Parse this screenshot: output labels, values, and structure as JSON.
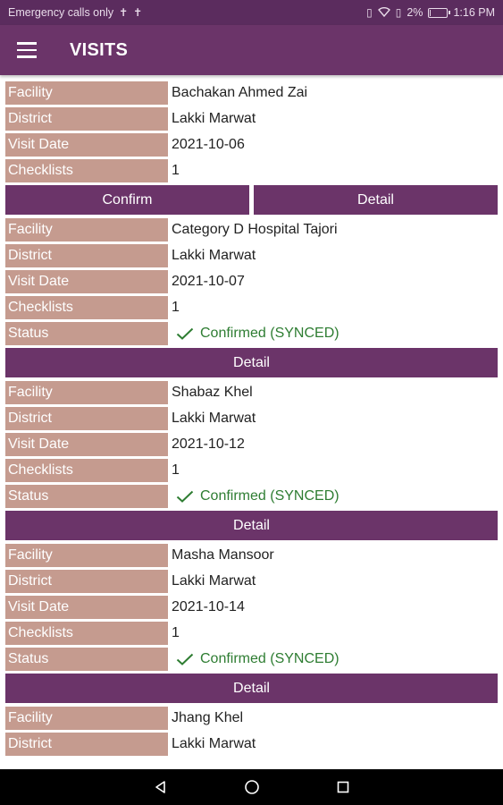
{
  "status_bar": {
    "left_text": "Emergency calls only",
    "battery": "2%",
    "time": "1:16 PM",
    "battery_level": 0.02
  },
  "app_bar": {
    "title": "VISITS"
  },
  "visits": [
    {
      "facility": {
        "label": "Facility",
        "value": "Bachakan Ahmed Zai"
      },
      "district": {
        "label": "District",
        "value": "Lakki Marwat"
      },
      "visit_date": {
        "label": "Visit Date",
        "value": "2021-10-06"
      },
      "checklists": {
        "label": "Checklists",
        "value": "1"
      },
      "confirm_label": "Confirm",
      "detail_label": "Detail"
    },
    {
      "facility": {
        "label": "Facility",
        "value": "Category D Hospital Tajori"
      },
      "district": {
        "label": "District",
        "value": "Lakki Marwat"
      },
      "visit_date": {
        "label": "Visit Date",
        "value": "2021-10-07"
      },
      "checklists": {
        "label": "Checklists",
        "value": "1"
      },
      "status": {
        "label": "Status",
        "value": "Confirmed (SYNCED)"
      },
      "detail_label": "Detail"
    },
    {
      "facility": {
        "label": "Facility",
        "value": "Shabaz Khel"
      },
      "district": {
        "label": "District",
        "value": "Lakki Marwat"
      },
      "visit_date": {
        "label": "Visit Date",
        "value": "2021-10-12"
      },
      "checklists": {
        "label": "Checklists",
        "value": "1"
      },
      "status": {
        "label": "Status",
        "value": "Confirmed (SYNCED)"
      },
      "detail_label": "Detail"
    },
    {
      "facility": {
        "label": "Facility",
        "value": "Masha Mansoor"
      },
      "district": {
        "label": "District",
        "value": "Lakki Marwat"
      },
      "visit_date": {
        "label": "Visit Date",
        "value": "2021-10-14"
      },
      "checklists": {
        "label": "Checklists",
        "value": "1"
      },
      "status": {
        "label": "Status",
        "value": "Confirmed (SYNCED)"
      },
      "detail_label": "Detail"
    },
    {
      "facility": {
        "label": "Facility",
        "value": "Jhang Khel"
      },
      "district": {
        "label": "District",
        "value": "Lakki Marwat"
      }
    }
  ],
  "colors": {
    "primary": "#6b3469",
    "status_bar": "#5b2c5e",
    "label_bg": "#c59b8f",
    "status_green": "#2e7d32"
  },
  "icons": {
    "menu": "hamburger-menu-icon",
    "status_check": "checkmark-icon",
    "nav_back": "back-triangle-icon",
    "nav_home": "home-circle-icon",
    "nav_recents": "recents-square-icon"
  }
}
